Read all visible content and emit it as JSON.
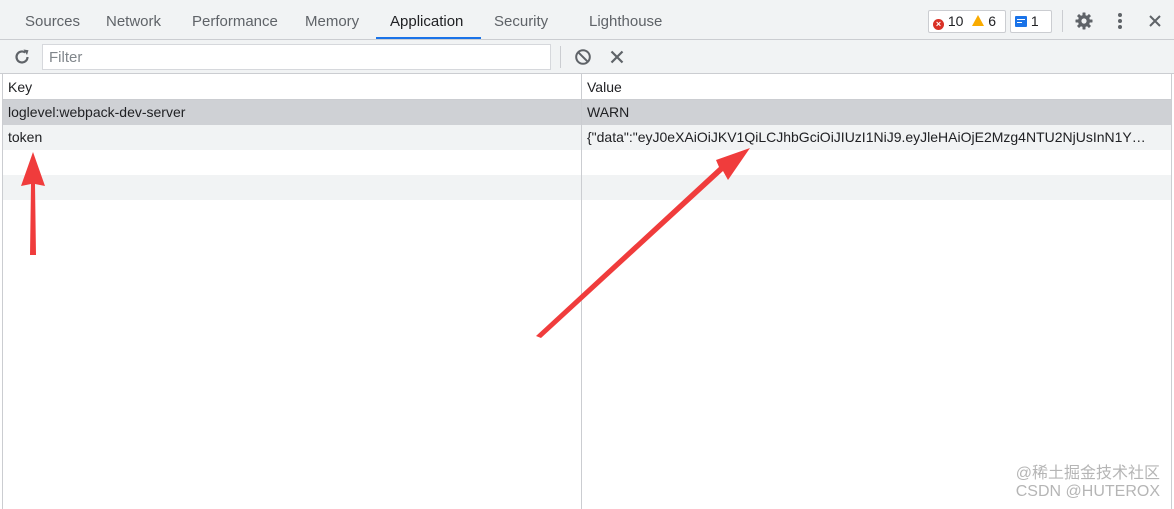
{
  "tabs": [
    {
      "label": "Sources"
    },
    {
      "label": "Network"
    },
    {
      "label": "Performance"
    },
    {
      "label": "Memory"
    },
    {
      "label": "Application",
      "active": true
    },
    {
      "label": "Security"
    },
    {
      "label": "Lighthouse"
    }
  ],
  "status": {
    "errors": "10",
    "warnings": "6",
    "messages": "1"
  },
  "toolbar": {
    "filter_placeholder": "Filter",
    "filter_value": ""
  },
  "table": {
    "columns": {
      "key": "Key",
      "value": "Value"
    },
    "rows": [
      {
        "key": "loglevel:webpack-dev-server",
        "value": "WARN",
        "selected": true
      },
      {
        "key": "token",
        "value": "{\"data\":\"eyJ0eXAiOiJKV1QiLCJhbGciOiJIUzI1NiJ9.eyJleHAiOjE2Mzg4NTU2NjUsInN1Y…"
      }
    ]
  },
  "watermark": {
    "line1": "@稀土掘金技术社区",
    "line2": "CSDN @HUTEROX"
  },
  "colors": {
    "accent": "#1a73e8",
    "arrow": "#f03c3c",
    "error": "#d93025",
    "warning": "#f9ab00"
  },
  "icons": [
    "refresh-icon",
    "clear-icon",
    "delete-icon",
    "error-icon",
    "warning-icon",
    "message-icon",
    "settings-icon",
    "more-icon",
    "close-icon"
  ]
}
